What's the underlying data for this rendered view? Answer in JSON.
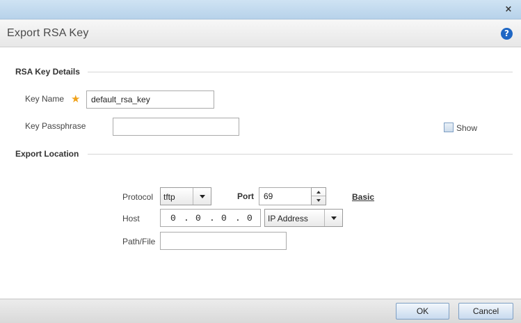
{
  "window": {
    "close_icon": "×"
  },
  "header": {
    "title": "Export RSA Key",
    "help_icon": "?"
  },
  "rsa_details": {
    "section_title": "RSA Key Details",
    "key_name_label": "Key Name",
    "required_star": "★",
    "key_name_value": "default_rsa_key",
    "key_passphrase_label": "Key Passphrase",
    "key_passphrase_value": "",
    "show_label": "Show"
  },
  "export_location": {
    "section_title": "Export Location",
    "protocol_label": "Protocol",
    "protocol_value": "tftp",
    "port_label": "Port",
    "port_value": "69",
    "basic_link": "Basic",
    "host_label": "Host",
    "host_ip": [
      "0",
      "0",
      "0",
      "0"
    ],
    "ip_dot": ".",
    "host_type_value": "IP Address",
    "path_label": "Path/File",
    "path_value": ""
  },
  "footer": {
    "ok_label": "OK",
    "cancel_label": "Cancel"
  },
  "colors": {
    "accent": "#1f67c4",
    "required": "#f0a21a",
    "titlebar": "#c3dbef"
  }
}
